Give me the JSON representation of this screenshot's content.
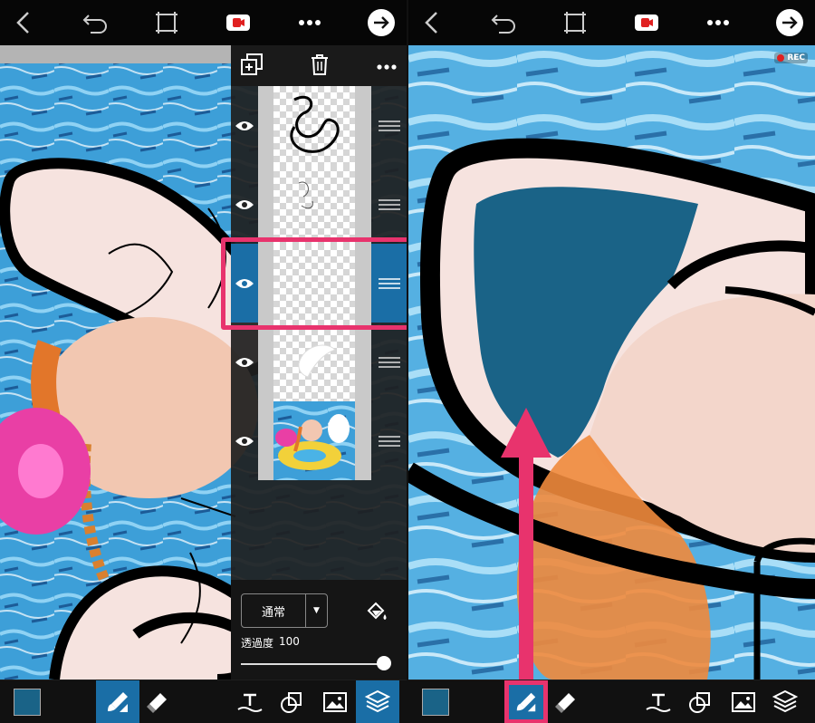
{
  "colors": {
    "accent": "#1a6ea6",
    "highlight": "#e8336d",
    "fill_color": "#1a6387",
    "record": "#e02020"
  },
  "topbar": {
    "icons": [
      "back-icon",
      "undo-icon",
      "crop-icon",
      "record-icon",
      "more-icon",
      "next-icon"
    ]
  },
  "layers_panel": {
    "toolbar_icons": [
      "duplicate-layer-icon",
      "trash-icon",
      "more-icon"
    ],
    "layers": [
      {
        "visible": true,
        "selected": false,
        "content": "line drawing"
      },
      {
        "visible": true,
        "selected": false,
        "content": "faint sketch"
      },
      {
        "visible": true,
        "selected": true,
        "content": "empty"
      },
      {
        "visible": true,
        "selected": false,
        "content": "white shape"
      },
      {
        "visible": true,
        "selected": false,
        "content": "photo"
      }
    ],
    "blend_mode": "通常",
    "opacity_label": "透過度",
    "opacity_value": "100",
    "opacity": 1.0
  },
  "rec_badge": "REC",
  "bottombar": {
    "icons": [
      "color-swatch",
      "brush-icon",
      "eraser-icon",
      "text-icon",
      "shape-icon",
      "image-icon",
      "layers-icon"
    ],
    "active_tool": "brush"
  }
}
